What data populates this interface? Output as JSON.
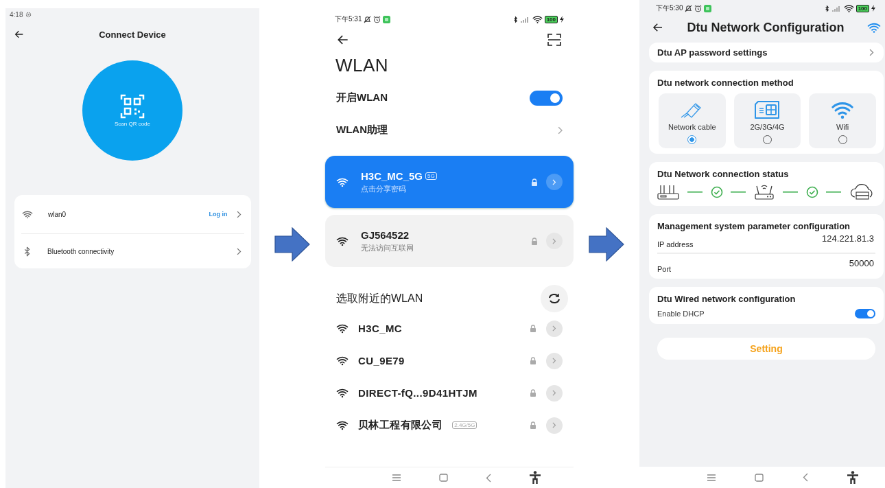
{
  "connect_device": {
    "status_time": "4:18",
    "title": "Connect Device",
    "scan_label": "Scan QR code",
    "connections": [
      {
        "kind": "wifi",
        "name": "wlan0",
        "action": "Log in"
      },
      {
        "kind": "bluetooth",
        "name": "Bluetooth connectivity"
      }
    ]
  },
  "wlan": {
    "status_time": "下午5:31",
    "battery": "100",
    "title": "WLAN",
    "wifi_toggle": {
      "label": "开启WLAN",
      "on": true
    },
    "assistant": "WLAN助理",
    "saved_networks": [
      {
        "name": "H3C_MC_5G",
        "tag": "5G",
        "status": "点击分享密码",
        "selected": true
      },
      {
        "name": "GJ564522",
        "status": "无法访问互联网",
        "selected": false
      }
    ],
    "nearby_heading": "选取附近的WLAN",
    "nearby_networks": [
      {
        "name": "H3C_MC"
      },
      {
        "name": "CU_9E79"
      },
      {
        "name": "DIRECT-fQ...9D41HTJM"
      },
      {
        "name": "贝林工程有限公司",
        "tag": "2.4G/5G"
      }
    ]
  },
  "dtu_config": {
    "status_time": "下午5:30",
    "battery": "100",
    "title": "Dtu Network Configuration",
    "ap_password": "Dtu AP password settings",
    "method": {
      "heading": "Dtu network connection method",
      "options": [
        {
          "kind": "cable",
          "label": "Network cable",
          "selected": true
        },
        {
          "kind": "cellular",
          "label": "2G/3G/4G",
          "selected": false
        },
        {
          "kind": "wifi",
          "label": "Wifi",
          "selected": false
        }
      ]
    },
    "status_heading": "Dtu Network connection status",
    "management": {
      "heading": "Management system parameter configuration",
      "fields": [
        {
          "label": "IP address",
          "value": "124.221.81.3"
        },
        {
          "label": "Port",
          "value": "50000"
        }
      ]
    },
    "wired": {
      "heading": "Dtu Wired network configuration",
      "dhcp": {
        "label": "Enable DHCP",
        "on": true
      }
    },
    "setting_button": "Setting"
  }
}
